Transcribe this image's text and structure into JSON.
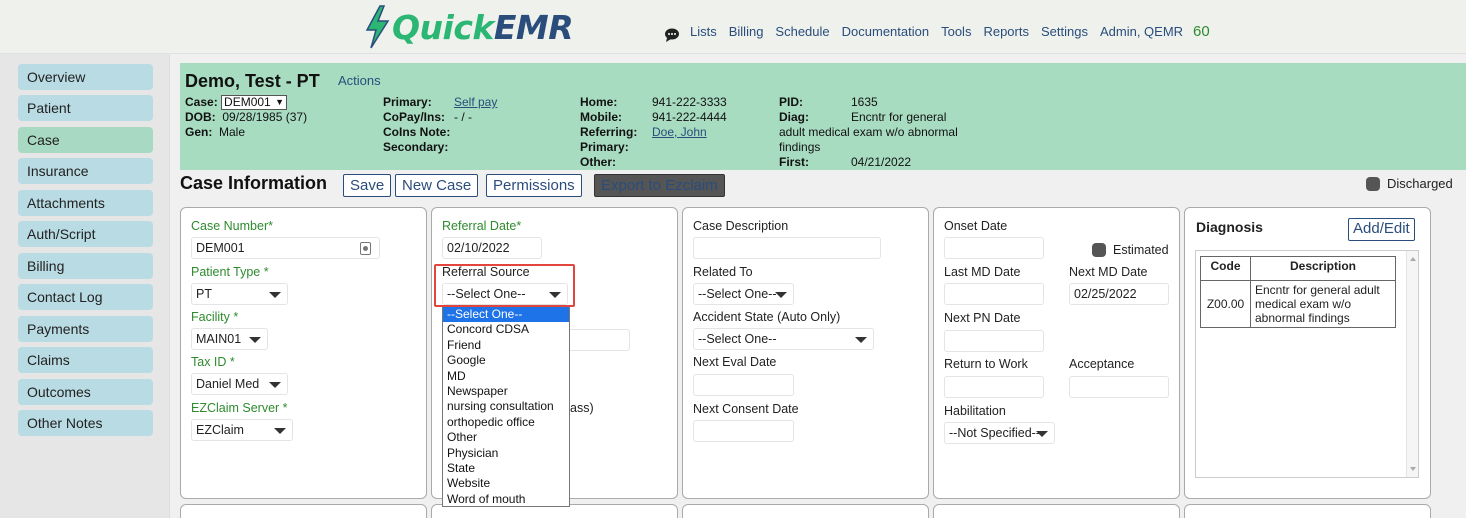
{
  "header": {
    "logo_quick": "Quick",
    "logo_emr": "EMR",
    "nav": [
      "Lists",
      "Billing",
      "Schedule",
      "Documentation",
      "Tools",
      "Reports",
      "Settings",
      "Admin, QEMR"
    ],
    "count": "60"
  },
  "sidebar": {
    "items": [
      "Overview",
      "Patient",
      "Case",
      "Insurance",
      "Attachments",
      "Auth/Script",
      "Billing",
      "Contact Log",
      "Payments",
      "Claims",
      "Outcomes",
      "Other Notes"
    ],
    "active": "Case"
  },
  "patient": {
    "name": "Demo, Test - PT",
    "actions": "Actions",
    "case_label": "Case:",
    "case_value": "DEM001",
    "dob_label": "DOB:",
    "dob_value": "09/28/1985 (37)",
    "gen_label": "Gen:",
    "gen_value": "Male",
    "primary_label": "Primary:",
    "primary_value": "Self pay",
    "copay_label": "CoPay/Ins:",
    "copay_value": "- / -",
    "coins_label": "CoIns Note:",
    "secondary_label": "Secondary:",
    "home_label": "Home:",
    "home_value": "941-222-3333",
    "mobile_label": "Mobile:",
    "mobile_value": "941-222-4444",
    "referring_label": "Referring:",
    "referring_value": "Doe, John",
    "primary2_label": "Primary:",
    "other_label": "Other:",
    "pid_label": "PID:",
    "pid_value": "1635",
    "diag_label": "Diag:",
    "diag_value_1": "Encntr for general",
    "diag_value_2": "adult medical exam w/o abnormal",
    "diag_value_3": "findings",
    "first_label": "First:",
    "first_value": "04/21/2022"
  },
  "toolbar": {
    "title": "Case Information",
    "save": "Save",
    "new_case": "New Case",
    "permissions": "Permissions",
    "export": "Export to Ezclaim",
    "discharged": "Discharged"
  },
  "panel1": {
    "case_number_label": "Case Number*",
    "case_number_value": "DEM001",
    "patient_type_label": "Patient Type *",
    "patient_type_value": "PT",
    "facility_label": "Facility *",
    "facility_value": "MAIN01",
    "tax_id_label": "Tax ID *",
    "tax_id_value": "Daniel Med",
    "ezclaim_label": "EZClaim Server *",
    "ezclaim_value": "EZClaim"
  },
  "panel2": {
    "referral_date_label": "Referral Date*",
    "referral_date_value": "02/10/2022",
    "referral_source_label": "Referral Source",
    "referral_source_value": "--Select One--",
    "partial_text": "ass)",
    "options": [
      "--Select One--",
      "Concord CDSA",
      "Friend",
      "Google",
      "MD",
      "Newspaper",
      "nursing consultation",
      "orthopedic office",
      "Other",
      "Physician",
      "State",
      "Website",
      "Word of mouth"
    ]
  },
  "panel3": {
    "case_description_label": "Case Description",
    "related_to_label": "Related To",
    "related_to_value": "--Select One--",
    "accident_state_label": "Accident State (Auto Only)",
    "accident_state_value": "--Select One--",
    "next_eval_label": "Next Eval Date",
    "next_consent_label": "Next Consent Date"
  },
  "panel4": {
    "onset_label": "Onset Date",
    "estimated_label": "Estimated",
    "last_md_label": "Last MD Date",
    "next_md_label": "Next MD Date",
    "next_md_value": "02/25/2022",
    "next_pn_label": "Next PN Date",
    "return_work_label": "Return to Work",
    "acceptance_label": "Acceptance",
    "habilitation_label": "Habilitation",
    "habilitation_value": "--Not Specified--"
  },
  "diagnosis": {
    "title": "Diagnosis",
    "add_edit": "Add/Edit",
    "col_code": "Code",
    "col_desc": "Description",
    "rows": [
      {
        "code": "Z00.00",
        "desc": "Encntr for general adult medical exam w/o abnormal findings"
      }
    ]
  }
}
